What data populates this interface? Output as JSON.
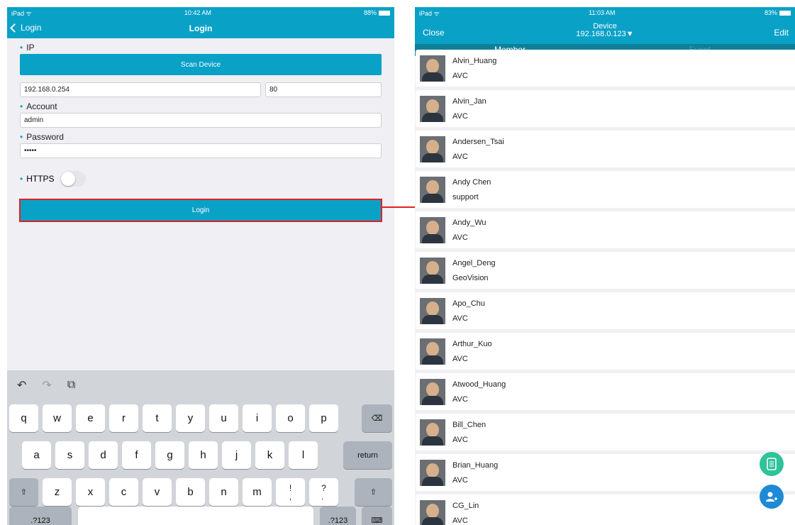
{
  "left": {
    "status": {
      "carrier": "iPad ᯤ",
      "time": "10:42 AM",
      "battery": "88%"
    },
    "nav": {
      "back_label": "Login",
      "title": "Login"
    },
    "ip_label": "IP",
    "scan_button": "Scan Device",
    "ip_value": "192.168.0.254",
    "port_value": "80",
    "account_label": "Account",
    "account_value": "admin",
    "password_label": "Password",
    "password_value": "•••••",
    "https_label": "HTTPS",
    "login_button": "Login",
    "keyboard": {
      "row1": [
        "q",
        "w",
        "e",
        "r",
        "t",
        "y",
        "u",
        "i",
        "o",
        "p"
      ],
      "row2": [
        "a",
        "s",
        "d",
        "f",
        "g",
        "h",
        "j",
        "k",
        "l"
      ],
      "row3": [
        "z",
        "x",
        "c",
        "v",
        "b",
        "n",
        "m",
        "!\n,",
        "?\n."
      ],
      "return_label": "return",
      "num_label": ".?123",
      "shift_glyph": "⇧",
      "delete_glyph": "⌫",
      "hide_glyph": "⌨",
      "tools": [
        "↶",
        "↷",
        "⧉"
      ]
    }
  },
  "right": {
    "status": {
      "carrier": "iPad ᯤ",
      "time": "11:03 AM",
      "battery": "83%"
    },
    "nav": {
      "close_label": "Close",
      "title": "Device",
      "subtitle": "192.168.0.123▼",
      "edit_label": "Edit"
    },
    "tabs": [
      {
        "label": "Member"
      },
      {
        "label": "Event"
      }
    ],
    "members": [
      {
        "name": "Alvin_Huang",
        "group": "AVC"
      },
      {
        "name": "Alvin_Jan",
        "group": "AVC"
      },
      {
        "name": "Andersen_Tsai",
        "group": "AVC"
      },
      {
        "name": "Andy Chen",
        "group": "support"
      },
      {
        "name": "Andy_Wu",
        "group": "AVC"
      },
      {
        "name": "Angel_Deng",
        "group": "GeoVision"
      },
      {
        "name": "Apo_Chu",
        "group": "AVC"
      },
      {
        "name": "Arthur_Kuo",
        "group": "AVC"
      },
      {
        "name": "Atwood_Huang",
        "group": "AVC"
      },
      {
        "name": "Bill_Chen",
        "group": "AVC"
      },
      {
        "name": "Brian_Huang",
        "group": "AVC"
      },
      {
        "name": "CG_Lin",
        "group": "AVC"
      }
    ],
    "fab_icons": [
      "tablet-icon",
      "add-person-icon"
    ]
  },
  "colors": {
    "accent": "#0aa1c7",
    "highlight": "#e32020",
    "fab_green": "#2ec39a",
    "fab_blue": "#1e8ad6"
  }
}
